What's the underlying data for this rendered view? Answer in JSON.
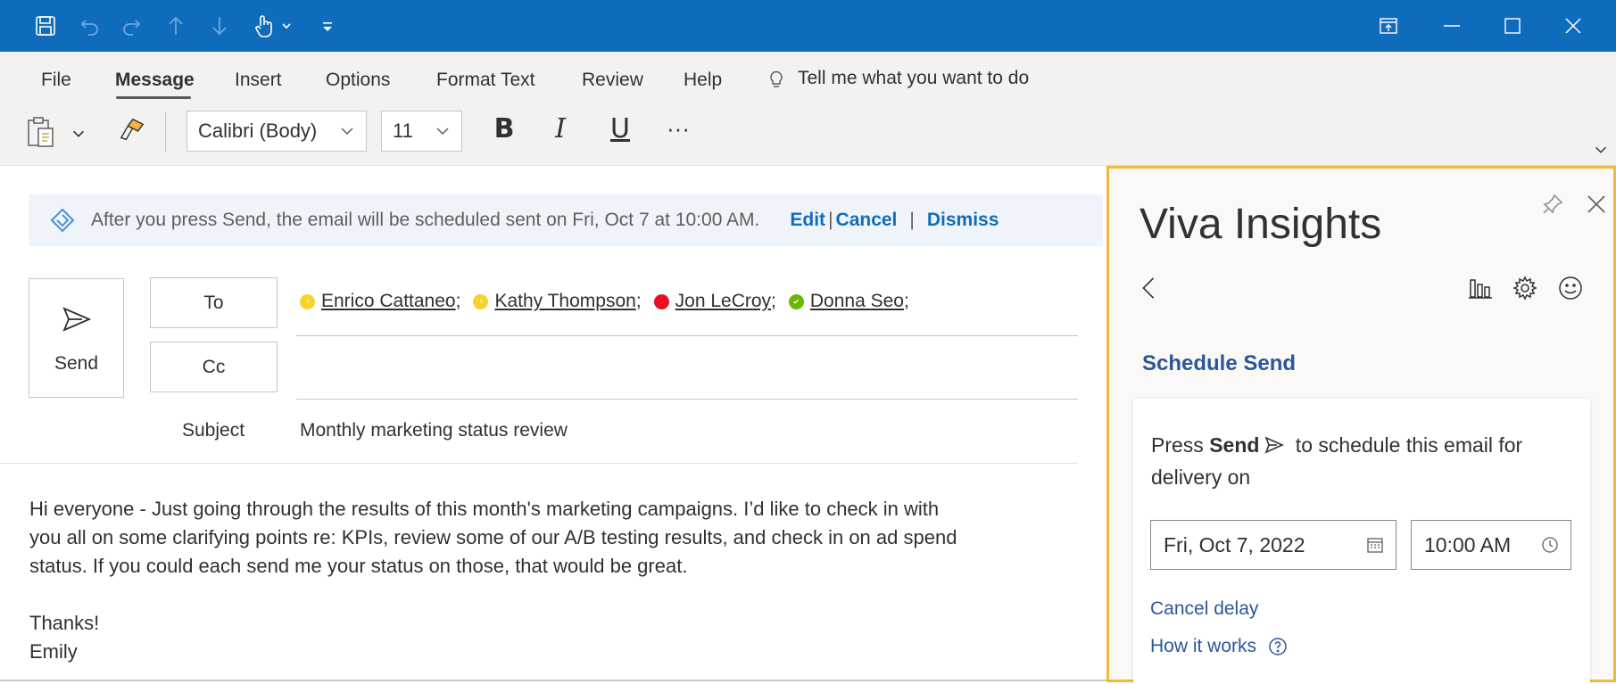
{
  "titlebar": {
    "icons": [
      "save-icon",
      "undo-icon",
      "redo-icon",
      "up-arrow-icon",
      "down-arrow-icon",
      "touch-mode-icon",
      "customize-qat-icon"
    ],
    "window_controls": [
      "restore-to-window-icon",
      "minimize-icon",
      "maximize-icon",
      "close-icon"
    ]
  },
  "menu": {
    "tabs": [
      {
        "label": "File"
      },
      {
        "label": "Message"
      },
      {
        "label": "Insert"
      },
      {
        "label": "Options"
      },
      {
        "label": "Format Text"
      },
      {
        "label": "Review"
      },
      {
        "label": "Help"
      }
    ],
    "active_tab": "Message",
    "tell_me": "Tell me what you want to do"
  },
  "toolbar": {
    "font_name": "Calibri (Body)",
    "font_size": "11",
    "bold": "B",
    "italic": "I",
    "underline": "U",
    "more": "···"
  },
  "banner": {
    "text": "After you press Send, the email will be scheduled sent on Fri, Oct 7 at 10:00 AM.",
    "edit": "Edit",
    "cancel": "Cancel",
    "dismiss": "Dismiss"
  },
  "compose": {
    "send_label": "Send",
    "to_label": "To",
    "cc_label": "Cc",
    "subject_label": "Subject",
    "subject": "Monthly marketing status review",
    "recipients": [
      {
        "name": "Enrico Cattaneo",
        "status": "away",
        "color": "#f8d22a"
      },
      {
        "name": "Kathy Thompson",
        "status": "away",
        "color": "#f8d22a"
      },
      {
        "name": "Jon LeCroy",
        "status": "busy",
        "color": "#e81123"
      },
      {
        "name": "Donna Seo",
        "status": "available",
        "color": "#6bb700"
      }
    ],
    "body": {
      "line1": "Hi everyone - Just going through the results of this month's marketing campaigns. I’d like to check in with",
      "line2": "you all on some clarifying points re: KPIs, review some of our A/B testing results, and check in on ad spend",
      "line3": "status. If you could each send me your status on those, that would be great.",
      "line4": "Thanks!",
      "line5": "Emily"
    }
  },
  "viva": {
    "title": "Viva Insights",
    "section": "Schedule Send",
    "instruction_pre": "Press ",
    "instruction_bold": "Send",
    "instruction_post": " to schedule this email for delivery on",
    "date": "Fri, Oct 7, 2022",
    "time": "10:00 AM",
    "cancel_delay": "Cancel delay",
    "how_it_works": "How it works",
    "accent": "#f0b93a"
  }
}
